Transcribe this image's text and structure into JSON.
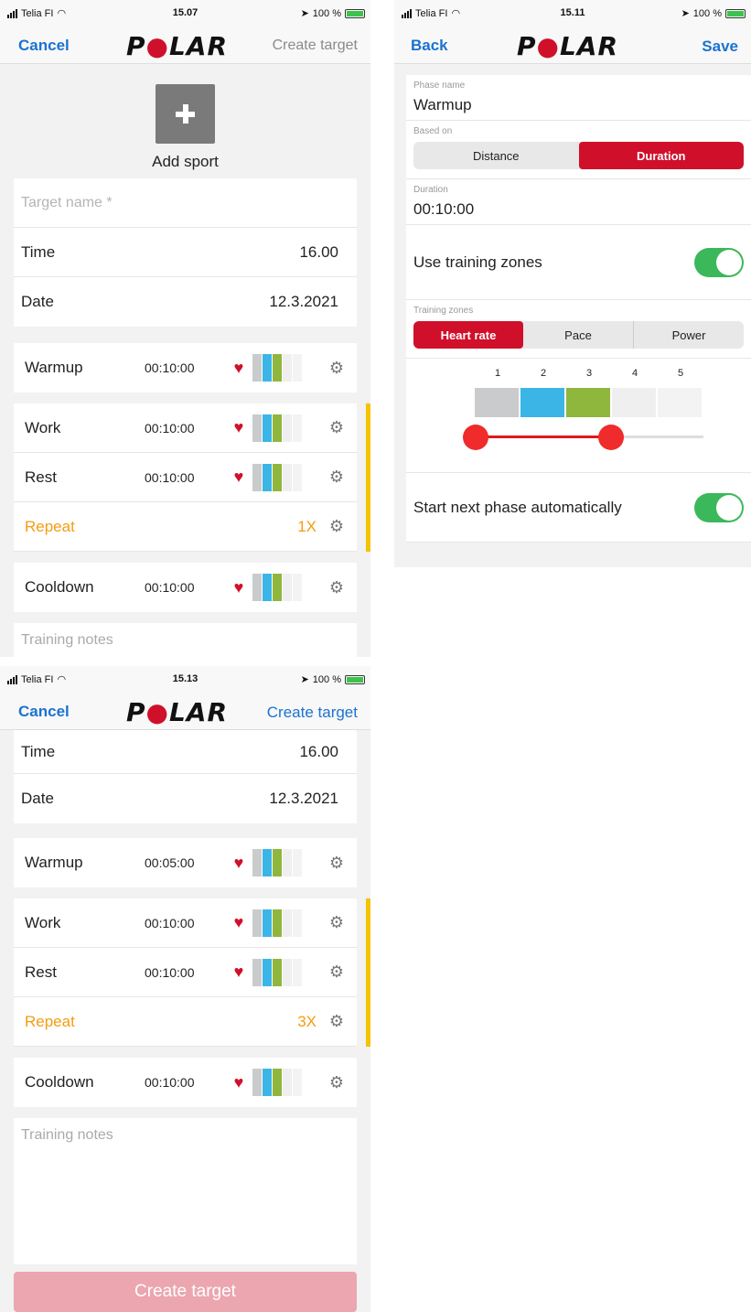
{
  "screen1": {
    "status": {
      "carrier": "Telia FI",
      "time": "15.07",
      "battery": "100 %"
    },
    "nav": {
      "left": "Cancel",
      "logo": "POLAR",
      "right": "Create target"
    },
    "add_sport": "Add sport",
    "target_name_placeholder": "Target name *",
    "time": {
      "label": "Time",
      "value": "16.00"
    },
    "date": {
      "label": "Date",
      "value": "12.3.2021"
    },
    "phases": [
      {
        "name": "Warmup",
        "duration": "00:10:00"
      },
      {
        "name": "Work",
        "duration": "00:10:00"
      },
      {
        "name": "Rest",
        "duration": "00:10:00"
      },
      {
        "name": "Cooldown",
        "duration": "00:10:00"
      }
    ],
    "repeat": {
      "label": "Repeat",
      "count": "1X"
    },
    "notes_placeholder": "Training notes"
  },
  "screen2": {
    "status": {
      "carrier": "Telia FI",
      "time": "15.11",
      "battery": "100 %"
    },
    "nav": {
      "left": "Back",
      "logo": "POLAR",
      "right": "Save"
    },
    "phase_name_label": "Phase name",
    "phase_name": "Warmup",
    "based_on_label": "Based on",
    "based_on": [
      "Distance",
      "Duration"
    ],
    "duration_label": "Duration",
    "duration": "00:10:00",
    "use_zones": "Use training zones",
    "zones_label": "Training zones",
    "zone_types": [
      "Heart rate",
      "Pace",
      "Power"
    ],
    "zone_numbers": [
      "1",
      "2",
      "3",
      "4",
      "5"
    ],
    "zone_range": {
      "from": 1,
      "to": 3
    },
    "auto_next": "Start next phase automatically"
  },
  "screen3": {
    "status": {
      "carrier": "Telia FI",
      "time": "15.13",
      "battery": "100 %"
    },
    "nav": {
      "left": "Cancel",
      "logo": "POLAR",
      "right": "Create target"
    },
    "time": {
      "label": "Time",
      "value": "16.00"
    },
    "date": {
      "label": "Date",
      "value": "12.3.2021"
    },
    "phases": [
      {
        "name": "Warmup",
        "duration": "00:05:00"
      },
      {
        "name": "Work",
        "duration": "00:10:00"
      },
      {
        "name": "Rest",
        "duration": "00:10:00"
      },
      {
        "name": "Cooldown",
        "duration": "00:10:00"
      }
    ],
    "repeat": {
      "label": "Repeat",
      "count": "3X"
    },
    "notes_placeholder": "Training notes",
    "create_button": "Create target"
  },
  "colors": {
    "accent": "#d0102a",
    "link": "#1a73d0",
    "repeat": "#f59c11",
    "toggle_on": "#3bb85a",
    "repeat_bracket": "#f5c300"
  }
}
